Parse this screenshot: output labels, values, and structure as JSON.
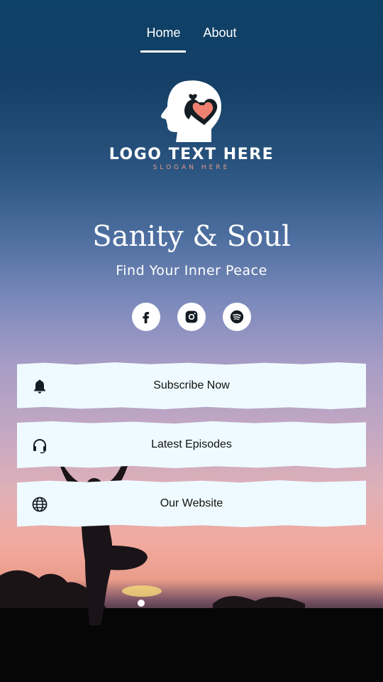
{
  "nav": {
    "tabs": [
      {
        "label": "Home",
        "active": true
      },
      {
        "label": "About",
        "active": false
      }
    ]
  },
  "logo": {
    "text": "LOGO TEXT HERE",
    "slogan": "SLOGAN HERE",
    "icon": "head-heart-logo-icon"
  },
  "hero": {
    "title": "Sanity & Soul",
    "subtitle": "Find Your Inner Peace"
  },
  "socials": [
    {
      "icon": "facebook-icon"
    },
    {
      "icon": "instagram-icon"
    },
    {
      "icon": "spotify-icon"
    }
  ],
  "buttons": [
    {
      "label": "Subscribe Now",
      "icon": "bell-icon"
    },
    {
      "label": "Latest Episodes",
      "icon": "headphones-icon"
    },
    {
      "label": "Our Website",
      "icon": "globe-icon"
    }
  ],
  "colors": {
    "accent": "#e89b8b",
    "button_bg": "#eefaff",
    "sky_top": "#0d4165"
  }
}
